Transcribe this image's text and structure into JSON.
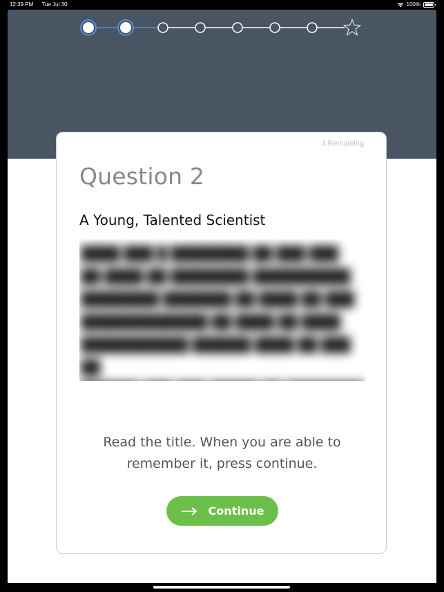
{
  "status_bar": {
    "time": "12:39 PM",
    "date": "Tue Jul 30",
    "battery": "100%",
    "icons": [
      "wifi-icon",
      "battery-icon"
    ]
  },
  "progress": {
    "total_steps": 7,
    "completed_steps": 2,
    "final_icon": "star-icon",
    "colors": {
      "done": "#ffffff",
      "done_ring": "#4f8fd9",
      "line_done": "#4f8fd9",
      "line_todo": "#ffffff"
    }
  },
  "card": {
    "remaining": "3 Remaining",
    "question_title": "Question 2",
    "passage_title": "A Young, Talented Scientist",
    "instruction": "Read the title. When you are able to remember it, press continue.",
    "continue_label": "Continue"
  },
  "colors": {
    "header": "#4a5563",
    "accent_green": "#6cc04a"
  }
}
